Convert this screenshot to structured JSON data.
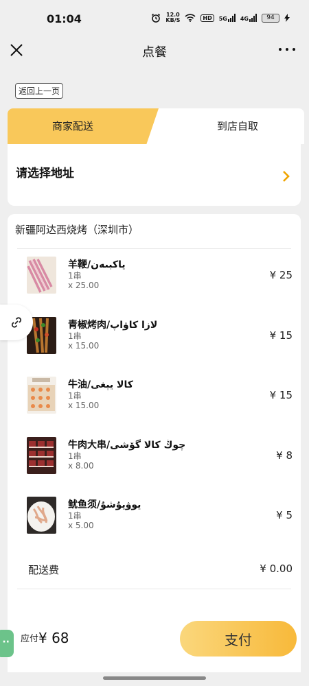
{
  "status_bar": {
    "time": "01:04",
    "net_speed": "12.0",
    "net_unit": "KB/S",
    "hd": "HD",
    "sig1": "5G",
    "sig2": "4G",
    "battery": "94"
  },
  "nav": {
    "title": "点餐"
  },
  "back_button": "返回上一页",
  "tabs": {
    "delivery": "商家配送",
    "pickup": "到店自取"
  },
  "address": {
    "prompt": "请选择地址"
  },
  "shop": {
    "name": "新疆阿达西烧烤（深圳市）"
  },
  "items": [
    {
      "name": "羊鞭/ياكبىەن",
      "unit": "1串",
      "qty": "x 25.00",
      "price": "¥ 25"
    },
    {
      "name": "青椒烤肉/لازا كاۋاپ",
      "unit": "1串",
      "qty": "x 15.00",
      "price": "¥ 15"
    },
    {
      "name": "牛油/كالا يېغى",
      "unit": "1串",
      "qty": "x 15.00",
      "price": "¥ 15"
    },
    {
      "name": "牛肉大串/چوڭ كالا گۆشى",
      "unit": "1串",
      "qty": "x 8.00",
      "price": "¥ 8"
    },
    {
      "name": "鱿鱼须/يوۋيۇشۇ",
      "unit": "1串",
      "qty": "x 5.00",
      "price": "¥ 5"
    }
  ],
  "delivery_fee": {
    "label": "配送费",
    "value": "¥ 0.00"
  },
  "payment": {
    "due_label": "应付",
    "due_amount": "¥ 68",
    "pay_label": "支付"
  },
  "green_float_glyph": "··",
  "colors": {
    "accent": "#f9c85a",
    "pay_gradient_end": "#f8b93a",
    "float_green": "#6cc38a"
  }
}
